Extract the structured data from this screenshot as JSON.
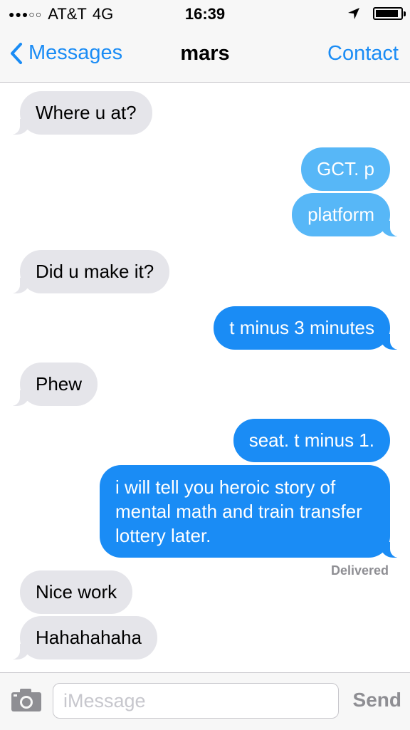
{
  "status_bar": {
    "carrier": "AT&T",
    "network": "4G",
    "time": "16:39",
    "signal_dots_filled": 3,
    "signal_dots_total": 5,
    "battery_level": 0.9
  },
  "nav": {
    "back_label": "Messages",
    "title": "mars",
    "contact_label": "Contact"
  },
  "messages": [
    {
      "text": "Where u at?",
      "direction": "incoming"
    },
    {
      "text": "GCT. p",
      "direction": "outgoing"
    },
    {
      "text": "platform",
      "direction": "outgoing"
    },
    {
      "text": "Did u make it?",
      "direction": "incoming"
    },
    {
      "text": "t minus 3 minutes",
      "direction": "outgoing"
    },
    {
      "text": "Phew",
      "direction": "incoming"
    },
    {
      "text": "seat. t minus 1.",
      "direction": "outgoing"
    },
    {
      "text": "i will tell you heroic story of mental math and train transfer lottery later.",
      "direction": "outgoing"
    },
    {
      "text": "Nice work",
      "direction": "incoming"
    },
    {
      "text": "Hahahahaha",
      "direction": "incoming"
    }
  ],
  "delivered_label": "Delivered",
  "compose": {
    "placeholder": "iMessage",
    "value": "",
    "send_label": "Send"
  },
  "colors": {
    "accent": "#1a8cf5",
    "outgoing_bubble": "#1a8cf5",
    "outgoing_bubble_sending": "#57b7f7",
    "incoming_bubble": "#e5e5ea"
  }
}
